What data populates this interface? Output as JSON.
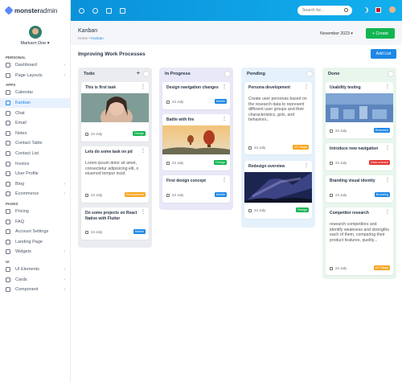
{
  "brand": {
    "name_bold": "monster",
    "name_light": "admin"
  },
  "profile": {
    "name": "Markarn Doe"
  },
  "sidebar": {
    "sections": {
      "personal": "PERSONAL",
      "apps": "APPS",
      "pages": "PAGES",
      "ui": "UI"
    },
    "items": [
      {
        "label": "Dashboard",
        "chevron": true
      },
      {
        "label": "Page Layouts",
        "chevron": true
      },
      {
        "label": "Calendar"
      },
      {
        "label": "Kanban",
        "active": true
      },
      {
        "label": "Chat"
      },
      {
        "label": "Email"
      },
      {
        "label": "Notes"
      },
      {
        "label": "Contact Table"
      },
      {
        "label": "Contact List"
      },
      {
        "label": "Invoice"
      },
      {
        "label": "User Profile"
      },
      {
        "label": "Blog",
        "chevron": true
      },
      {
        "label": "Ecommerce",
        "chevron": true
      },
      {
        "label": "Pricing"
      },
      {
        "label": "FAQ"
      },
      {
        "label": "Account Settings"
      },
      {
        "label": "Landing Page"
      },
      {
        "label": "Widgets",
        "chevron": true
      },
      {
        "label": "UI Elements",
        "chevron": true
      },
      {
        "label": "Cards",
        "chevron": true
      },
      {
        "label": "Component",
        "chevron": true
      }
    ]
  },
  "topbar": {
    "search_placeholder": "Search for..."
  },
  "header": {
    "title": "Kanban",
    "breadcrumb_home": "Home",
    "breadcrumb_current": "Kanban",
    "month": "November 2023",
    "create_label": "+ Create"
  },
  "board": {
    "title": "Improving Work Processes",
    "add_list_label": "Add List",
    "columns": [
      {
        "title": "Todo",
        "cards": [
          {
            "title": "This is first task",
            "date": "24 July",
            "badge": "Design"
          },
          {
            "title": "Lets do some task on pd",
            "body": "Lorem ipsum dolor sit amet, consectetur adipisicing elit, o eiusmod tempor incid.",
            "date": "24 July",
            "badge": "Development"
          },
          {
            "title": "Do some projects on React Native with Flutter",
            "date": "24 July",
            "badge": "Mobile"
          }
        ]
      },
      {
        "title": "In Progress",
        "cards": [
          {
            "title": "Design navigation changes",
            "date": "24 July",
            "badge": "Mobile"
          },
          {
            "title": "Battle with fire",
            "date": "24 July",
            "badge": "Design"
          },
          {
            "title": "First design concept",
            "date": "24 July",
            "badge": "Mobile"
          }
        ]
      },
      {
        "title": "Pending",
        "cards": [
          {
            "title": "Persona development",
            "body": "Create user personas based on the research data to represent different user groups and their characteristics, gols, and behaviors..",
            "date": "24 July",
            "badge": "UX Stage"
          },
          {
            "title": "Redesign overview",
            "date": "24 July",
            "badge": "Design"
          }
        ]
      },
      {
        "title": "Done",
        "cards": [
          {
            "title": "Usability testing",
            "date": "24 July",
            "badge": "Research"
          },
          {
            "title": "Introduce new navigation",
            "date": "24 July",
            "badge": "Data science"
          },
          {
            "title": "Branding visual identity",
            "date": "24 July",
            "badge": "Branding"
          },
          {
            "title": "Competitor research",
            "body": "research competitors and identify weakness and strengths each of them, comparing their product features, quelity...",
            "date": "24 July",
            "badge": "UX Stage"
          }
        ]
      }
    ]
  },
  "badge_colors": {
    "Design": "#13b552",
    "Development": "#f6a623",
    "Mobile": "#1e88e5",
    "UX Stage": "#f6a623",
    "Research": "#1e88e5",
    "Data science": "#e53935",
    "Branding": "#1e88e5"
  }
}
